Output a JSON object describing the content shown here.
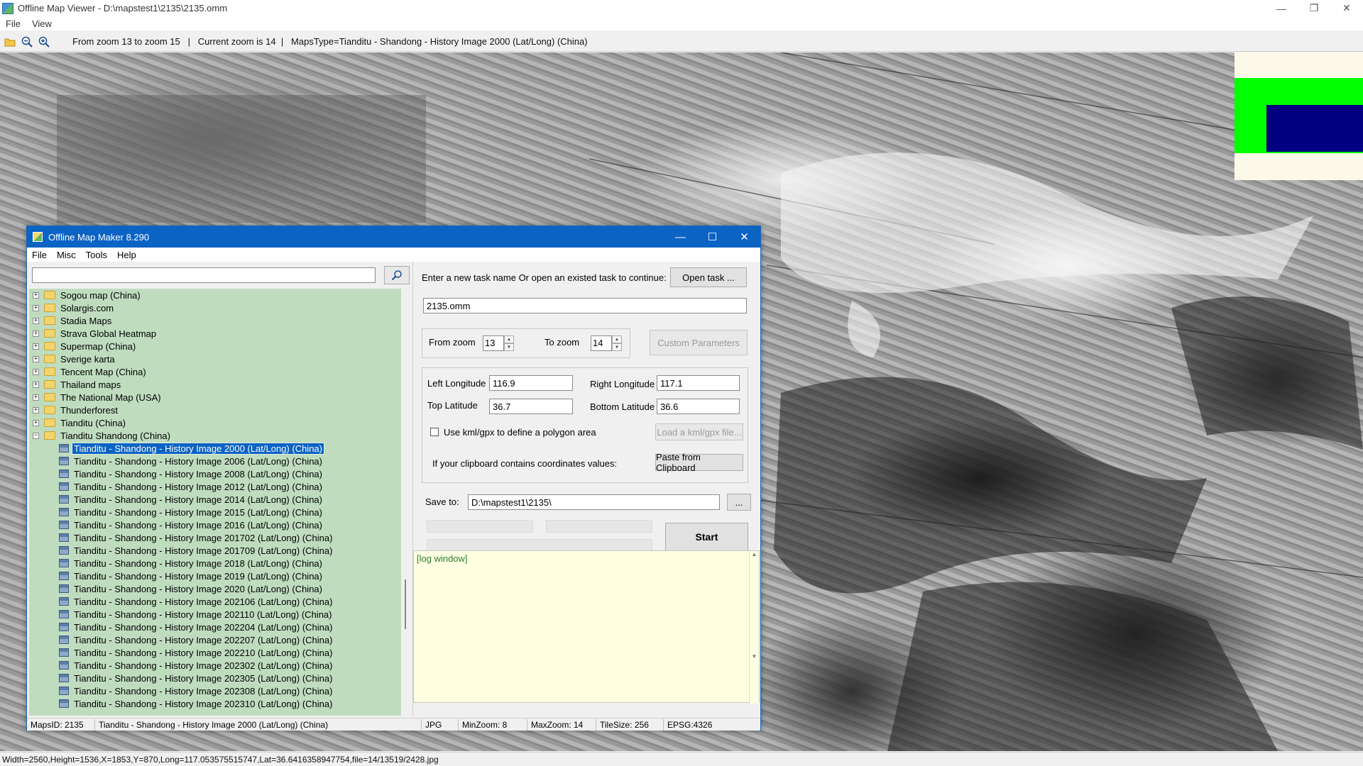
{
  "viewer": {
    "title": "Offline Map Viewer - D:\\mapstest1\\2135\\2135.omm",
    "menu": [
      "File",
      "View"
    ],
    "toolbar_status": "From zoom 13 to zoom 15   |   Current zoom is 14  |   MapsType=Tianditu - Shandong - History Image 2000 (Lat/Long) (China)",
    "status_line": "Width=2560,Height=1536,X=1853,Y=870,Long=117.053575515747,Lat=36.6416358947754,file=14/13519/2428.jpg",
    "colors": {
      "minimap_bg": "#fdf9e8",
      "minimap_green": "#00ff00",
      "minimap_blue": "#000080"
    }
  },
  "dialog": {
    "title": "Offline Map Maker 8.290",
    "menu": [
      "File",
      "Misc",
      "Tools",
      "Help"
    ],
    "search": {
      "value": "",
      "placeholder": ""
    },
    "tree": {
      "folders": [
        "Sogou map (China)",
        "Solargis.com",
        "Stadia Maps",
        "Strava Global Heatmap",
        "Supermap (China)",
        "Sverige karta",
        "Tencent Map (China)",
        "Thailand maps",
        "The National Map (USA)",
        "Thunderforest",
        "Tianditu (China)"
      ],
      "open_folder": "Tianditu Shandong (China)",
      "children": [
        "Tianditu - Shandong - History Image 2000 (Lat/Long) (China)",
        "Tianditu - Shandong - History Image 2006 (Lat/Long) (China)",
        "Tianditu - Shandong - History Image 2008 (Lat/Long) (China)",
        "Tianditu - Shandong - History Image 2012 (Lat/Long) (China)",
        "Tianditu - Shandong - History Image 2014 (Lat/Long) (China)",
        "Tianditu - Shandong - History Image 2015 (Lat/Long) (China)",
        "Tianditu - Shandong - History Image 2016 (Lat/Long) (China)",
        "Tianditu - Shandong - History Image 201702 (Lat/Long) (China)",
        "Tianditu - Shandong - History Image 201709 (Lat/Long) (China)",
        "Tianditu - Shandong - History Image 2018 (Lat/Long) (China)",
        "Tianditu - Shandong - History Image 2019 (Lat/Long) (China)",
        "Tianditu - Shandong - History Image 2020 (Lat/Long) (China)",
        "Tianditu - Shandong - History Image 202106 (Lat/Long) (China)",
        "Tianditu - Shandong - History Image 202110 (Lat/Long) (China)",
        "Tianditu - Shandong - History Image 202204 (Lat/Long) (China)",
        "Tianditu - Shandong - History Image 202207 (Lat/Long) (China)",
        "Tianditu - Shandong - History Image 202210 (Lat/Long) (China)",
        "Tianditu - Shandong - History Image 202302 (Lat/Long) (China)",
        "Tianditu - Shandong - History Image 202305 (Lat/Long) (China)",
        "Tianditu - Shandong - History Image 202308 (Lat/Long) (China)",
        "Tianditu - Shandong - History Image 202310 (Lat/Long) (China)"
      ],
      "selected_index": 0
    },
    "task": {
      "prompt": "Enter a new task name Or open an existed task to continue:",
      "open_task_label": "Open task ...",
      "task_name": "2135.omm"
    },
    "zoom": {
      "from_label": "From zoom",
      "from_value": "13",
      "to_label": "To zoom",
      "to_value": "14",
      "custom_params_label": "Custom Parameters"
    },
    "bounds": {
      "left_lon_label": "Left Longitude",
      "left_lon": "116.9",
      "right_lon_label": "Right Longitude",
      "right_lon": "117.1",
      "top_lat_label": "Top Latitude",
      "top_lat": "36.7",
      "bottom_lat_label": "Bottom Latitude",
      "bottom_lat": "36.6",
      "kml_label": "Use kml/gpx to define a polygon area",
      "load_kml_label": "Load a kml/gpx file...",
      "clipboard_label": "If your clipboard contains coordinates values:",
      "paste_label": "Paste from Clipboard"
    },
    "save": {
      "label": "Save to:",
      "path": "D:\\mapstest1\\2135\\",
      "browse_label": "..."
    },
    "start_label": "Start",
    "log_text": "[log window]",
    "status": {
      "maps_id": "MapsID: 2135",
      "map_name": "Tianditu - Shandong - History Image 2000 (Lat/Long) (China)",
      "format": "JPG",
      "min_zoom": "MinZoom: 8",
      "max_zoom": "MaxZoom: 14",
      "tile_size": "TileSize: 256",
      "epsg": "EPSG:4326"
    }
  }
}
